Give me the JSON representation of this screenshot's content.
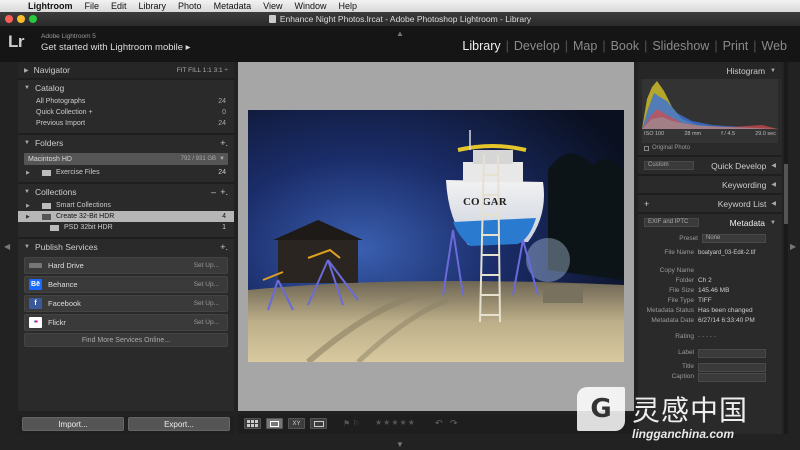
{
  "menubar": {
    "items": [
      "Lightroom",
      "File",
      "Edit",
      "Library",
      "Photo",
      "Metadata",
      "View",
      "Window",
      "Help"
    ]
  },
  "window": {
    "title": "Enhance Night Photos.lrcat - Adobe Photoshop Lightroom - Library"
  },
  "identity": {
    "logo": "Lr",
    "version": "Adobe Lightroom 5",
    "mobile": "Get started with Lightroom mobile  ▸"
  },
  "modules": {
    "items": [
      "Library",
      "Develop",
      "Map",
      "Book",
      "Slideshow",
      "Print",
      "Web"
    ],
    "active": "Library"
  },
  "left": {
    "navigator": {
      "title": "Navigator",
      "zoom": "FIT  FILL  1:1  3:1 ÷"
    },
    "catalog": {
      "title": "Catalog",
      "rows": [
        {
          "label": "All Photographs",
          "count": "24"
        },
        {
          "label": "Quick Collection +",
          "count": "0"
        },
        {
          "label": "Previous Import",
          "count": "24"
        }
      ]
    },
    "folders": {
      "title": "Folders",
      "drive": {
        "label": "Macintosh HD",
        "cap": "792 / 931 GB"
      },
      "rows": [
        {
          "label": "Exercise Files",
          "count": "24"
        }
      ]
    },
    "collections": {
      "title": "Collections",
      "rows": [
        {
          "label": "Smart Collections",
          "count": ""
        },
        {
          "label": "Create 32-Bit HDR",
          "count": "4"
        },
        {
          "label": "PSD 32bit HDR",
          "count": "1"
        }
      ]
    },
    "publish": {
      "title": "Publish Services",
      "services": [
        {
          "label": "Hard Drive",
          "setup": "Set Up...",
          "icon": "hard-drive-icon",
          "color": "#777777"
        },
        {
          "label": "Behance",
          "setup": "Set Up...",
          "icon": "behance-icon",
          "color": "#1769ff",
          "glyph": "Bē"
        },
        {
          "label": "Facebook",
          "setup": "Set Up...",
          "icon": "facebook-icon",
          "color": "#3b5998",
          "glyph": "f"
        },
        {
          "label": "Flickr",
          "setup": "Set Up...",
          "icon": "flickr-icon",
          "color": "#ffffff",
          "glyph": "••"
        }
      ],
      "find_more": "Find More Services Online..."
    },
    "buttons": {
      "import": "Import...",
      "export": "Export..."
    }
  },
  "right": {
    "histogram": {
      "title": "Histogram",
      "iso": "ISO 100",
      "focal": "28 mm",
      "aperture": "f / 4.5",
      "shutter": "29.0 sec",
      "original_photo": "Original Photo"
    },
    "quick_develop": {
      "preset": "Custom",
      "title": "Quick Develop"
    },
    "keywording": {
      "title": "Keywording"
    },
    "keyword_list": {
      "title": "Keyword List"
    },
    "metadata": {
      "title": "Metadata",
      "view": "EXIF and IPTC",
      "preset_label": "Preset",
      "preset_value": "None",
      "fields": [
        {
          "k": "File Name",
          "v": "boatyard_03-Edit-2.tif"
        },
        {
          "k": "Copy Name",
          "v": ""
        },
        {
          "k": "Folder",
          "v": "Ch 2"
        },
        {
          "k": "File Size",
          "v": "145.46 MB"
        },
        {
          "k": "File Type",
          "v": "TIFF"
        },
        {
          "k": "Metadata Status",
          "v": "Has been changed"
        },
        {
          "k": "Metadata Date",
          "v": "6/27/14 6:33:40 PM"
        }
      ],
      "rating_label": "Rating",
      "rating_value": "· · · · ·",
      "label_label": "Label",
      "title_label": "Title",
      "caption_label": "Caption"
    }
  },
  "photo": {
    "boat_name": "CO  GAR"
  },
  "toolbar": {
    "stars": "★★★★★"
  },
  "watermark": {
    "text": "灵感中国",
    "url": "lingganchina.com"
  }
}
